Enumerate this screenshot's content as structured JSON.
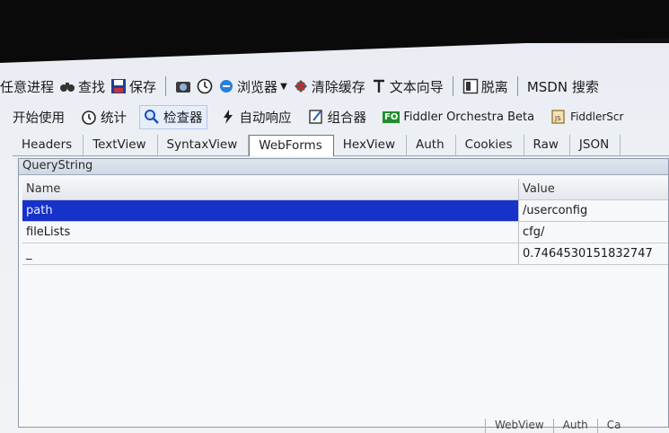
{
  "toolbar": {
    "items": [
      {
        "label": "任意进程",
        "icon": "crosshair-icon"
      },
      {
        "label": "查找",
        "icon": "binoculars-icon"
      },
      {
        "label": "保存",
        "icon": "save-icon"
      },
      {
        "label": "",
        "icon": "camera-icon"
      },
      {
        "label": "",
        "icon": "timer-icon"
      },
      {
        "label": "浏览器",
        "icon": "ie-browser-icon"
      },
      {
        "label": "清除缓存",
        "icon": "clear-cache-icon"
      },
      {
        "label": "文本向导",
        "icon": "text-wizard-icon"
      },
      {
        "label": "脱离",
        "icon": "tearoff-icon"
      },
      {
        "label": "MSDN 搜索",
        "icon": ""
      }
    ]
  },
  "main_tabs": [
    {
      "label": "开始使用",
      "icon": ""
    },
    {
      "label": "统计",
      "icon": "stopwatch-icon"
    },
    {
      "label": "检查器",
      "icon": "inspector-icon",
      "active": true
    },
    {
      "label": "自动响应",
      "icon": "lightning-icon"
    },
    {
      "label": "组合器",
      "icon": "composer-icon"
    },
    {
      "label": "Fiddler Orchestra Beta",
      "icon": "fo-icon"
    },
    {
      "label": "FiddlerScr",
      "icon": "script-icon"
    }
  ],
  "inspector_tabs": [
    "Headers",
    "TextView",
    "SyntaxView",
    "WebForms",
    "HexView",
    "Auth",
    "Cookies",
    "Raw",
    "JSON"
  ],
  "active_inspector_tab": "WebForms",
  "querystring": {
    "title": "QueryString",
    "columns": {
      "name": "Name",
      "value": "Value"
    },
    "rows": [
      {
        "name": "path",
        "value": "/userconfig"
      },
      {
        "name": "fileLists",
        "value": "cfg/"
      },
      {
        "name": "_",
        "value": "0.7464530151832747"
      }
    ]
  },
  "bottom_tabs": [
    "WebView",
    "Auth",
    "Ca"
  ],
  "colors": {
    "selection": "#1732c9",
    "panel_bg": "#f7f8fa"
  }
}
